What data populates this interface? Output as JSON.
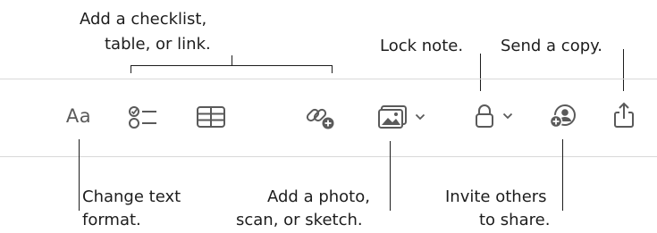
{
  "callouts": {
    "checklist": {
      "line1": "Add a checklist,",
      "line2": "table, or link."
    },
    "lock": "Lock note.",
    "send": "Send a copy.",
    "format": {
      "line1": "Change text",
      "line2": "format."
    },
    "photo": {
      "line1": "Add a photo,",
      "line2": "scan, or sketch."
    },
    "invite": {
      "line1": "Invite others",
      "line2": "to share."
    }
  },
  "toolbar": {
    "format_label": "Aa",
    "icons": [
      "text-format-icon",
      "checklist-icon",
      "table-icon",
      "link-icon",
      "photo-icon",
      "lock-icon",
      "collaborate-icon",
      "share-icon"
    ]
  },
  "colors": {
    "icon": "#5a5a5a",
    "text": "#1d1d1d",
    "separator": "#d9d9d9"
  }
}
